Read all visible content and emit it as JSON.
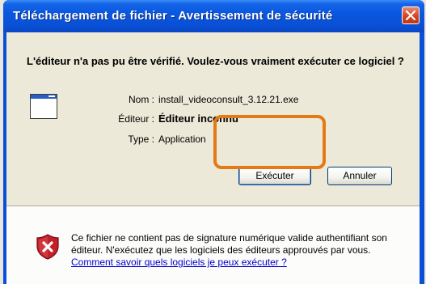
{
  "dialog": {
    "title": "Téléchargement de fichier - Avertissement de sécurité",
    "question": "L'éditeur n'a pas pu être vérifié. Voulez-vous vraiment exécuter ce logiciel ?",
    "fields": {
      "name_label": "Nom :",
      "name_value": "install_videoconsult_3.12.21.exe",
      "publisher_label": "Éditeur :",
      "publisher_value": "Éditeur inconnu",
      "type_label": "Type :",
      "type_value": "Application"
    },
    "buttons": {
      "run": "Exécuter",
      "cancel": "Annuler"
    },
    "warning_text": "Ce fichier ne contient pas de signature numérique valide authentifiant son éditeur. N'exécutez que les logiciels des éditeurs approuvés par vous.",
    "warning_link": "Comment savoir quels logiciels je peux exécuter ?"
  },
  "icons": {
    "close": "close-icon",
    "app": "application-icon",
    "shield": "security-shield-icon"
  },
  "colors": {
    "titlebar": "#0a57df",
    "highlight": "#e37a14",
    "link": "#0000cc"
  }
}
